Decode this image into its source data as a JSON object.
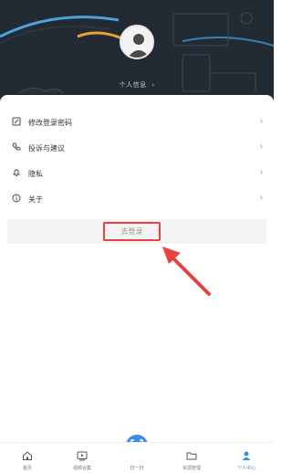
{
  "header": {
    "profile_link": "个人信息",
    "chevron": "›"
  },
  "menu": {
    "items": [
      {
        "label": "修改登录密码",
        "icon": "edit-icon"
      },
      {
        "label": "投诉与建议",
        "icon": "phone-icon"
      },
      {
        "label": "隐私",
        "icon": "bell-icon"
      },
      {
        "label": "关于",
        "icon": "info-icon"
      }
    ],
    "chevron": "›"
  },
  "login": {
    "label": "去登录"
  },
  "tabbar": {
    "items": [
      {
        "label": "首页",
        "icon": "home-icon"
      },
      {
        "label": "视频合集",
        "icon": "video-icon"
      },
      {
        "label": "扫一扫",
        "icon": "scan-icon"
      },
      {
        "label": "资源管理",
        "icon": "folder-icon"
      },
      {
        "label": "个人中心",
        "icon": "person-icon"
      }
    ]
  },
  "colors": {
    "header_bg": "#222a33",
    "accent_blue": "#3a8ee6",
    "highlight_red": "#e8423f"
  }
}
